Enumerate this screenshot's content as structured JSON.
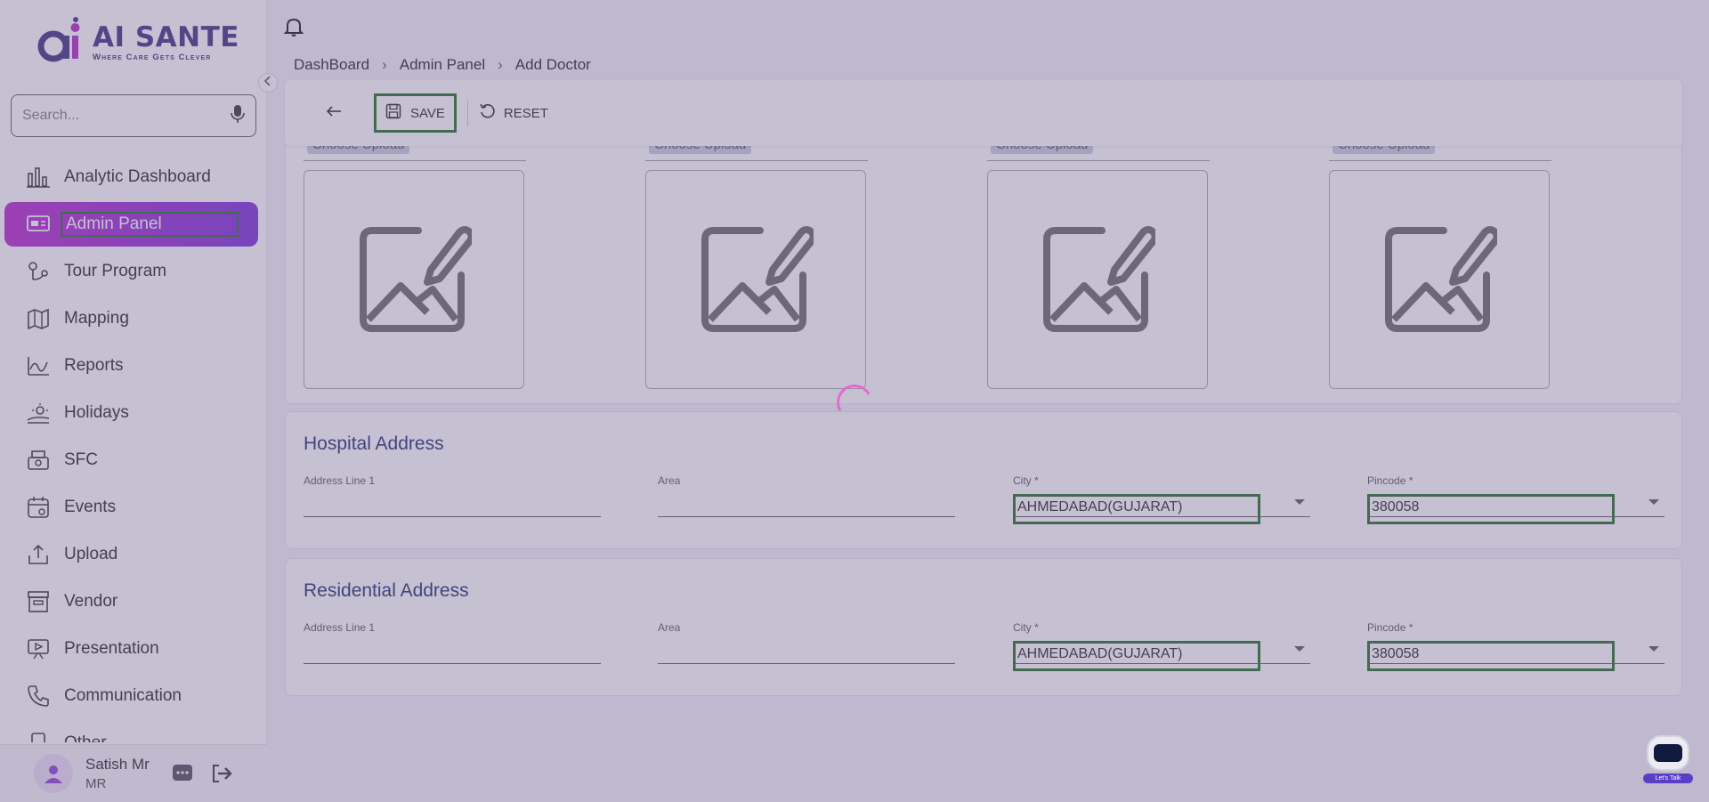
{
  "app": {
    "logo_title": "AI SANTE",
    "logo_tagline": "Where Care Gets Clever",
    "colors": {
      "brand": "#3a2d7d",
      "active_nav_start": "#b624c9",
      "active_nav_end": "#7a2bd8",
      "section_title": "#1b2a6b"
    }
  },
  "search": {
    "placeholder": "Search...",
    "icon": "microphone-icon"
  },
  "sidebar": {
    "items": [
      {
        "label": "Analytic Dashboard",
        "icon": "bar-chart-icon"
      },
      {
        "label": "Admin Panel",
        "icon": "admin-monitor-icon",
        "active": true
      },
      {
        "label": "Tour Program",
        "icon": "route-pin-icon"
      },
      {
        "label": "Mapping",
        "icon": "map-icon"
      },
      {
        "label": "Reports",
        "icon": "report-chart-icon"
      },
      {
        "label": "Holidays",
        "icon": "beach-sun-icon"
      },
      {
        "label": "SFC",
        "icon": "cash-register-icon"
      },
      {
        "label": "Events",
        "icon": "calendar-icon"
      },
      {
        "label": "Upload",
        "icon": "upload-icon"
      },
      {
        "label": "Vendor",
        "icon": "vendor-icon"
      },
      {
        "label": "Presentation",
        "icon": "presentation-icon"
      },
      {
        "label": "Communication",
        "icon": "phone-icon"
      },
      {
        "label": "Other",
        "icon": "other-icon"
      }
    ]
  },
  "user": {
    "name": "Satish Mr",
    "role": "MR"
  },
  "breadcrumb": [
    "DashBoard",
    "Admin Panel",
    "Add Doctor"
  ],
  "toolbar": {
    "save_label": "SAVE",
    "reset_label": "RESET"
  },
  "uploads": {
    "chip_label": "Choose Upload",
    "slots": 4
  },
  "hospital_address": {
    "title": "Hospital Address",
    "address_label": "Address Line 1",
    "address_value": "",
    "area_label": "Area",
    "area_value": "",
    "city_label": "City *",
    "city_value": "AHMEDABAD(GUJARAT)",
    "pincode_label": "Pincode *",
    "pincode_value": "380058"
  },
  "residential_address": {
    "title": "Residential Address",
    "address_label": "Address Line 1",
    "address_value": "",
    "area_label": "Area",
    "area_value": "",
    "city_label": "City *",
    "city_value": "AHMEDABAD(GUJARAT)",
    "pincode_label": "Pincode *",
    "pincode_value": "380058"
  },
  "chatbot": {
    "label": "Let's Talk"
  }
}
